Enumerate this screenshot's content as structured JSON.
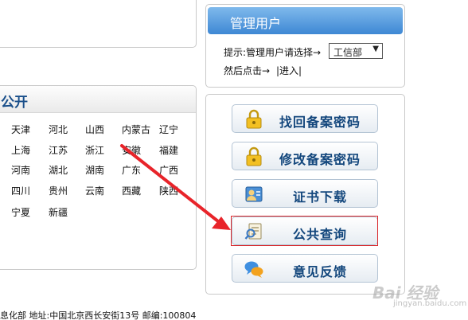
{
  "region": {
    "title": "公开",
    "provinces": [
      [
        "天津",
        "河北",
        "山西",
        "内蒙古",
        "辽宁"
      ],
      [
        "上海",
        "江苏",
        "浙江",
        "安徽",
        "福建"
      ],
      [
        "河南",
        "湖北",
        "湖南",
        "广东",
        "广西"
      ],
      [
        "四川",
        "贵州",
        "云南",
        "西藏",
        "陕西"
      ],
      [
        "宁夏",
        "新疆"
      ]
    ]
  },
  "manage": {
    "title": "管理用户",
    "hint": "提示:管理用户请选择→",
    "dept_selected": "工信部",
    "then": "然后点击→",
    "enter_label": "|进入|"
  },
  "buttons": {
    "recover_password": "找回备案密码",
    "modify_password": "修改备案密码",
    "cert_download": "证书下载",
    "public_query": "公共查询",
    "feedback": "意见反馈"
  },
  "footer": {
    "text": "息化部 地址:中国北京西长安街13号 邮编:100804"
  },
  "watermark": {
    "text": "Bai 经验",
    "sub": "jingyan.baidu.com"
  },
  "colors": {
    "brand_blue": "#12467c",
    "header_blue": "#3e88d4",
    "highlight_red": "#d9262a"
  }
}
